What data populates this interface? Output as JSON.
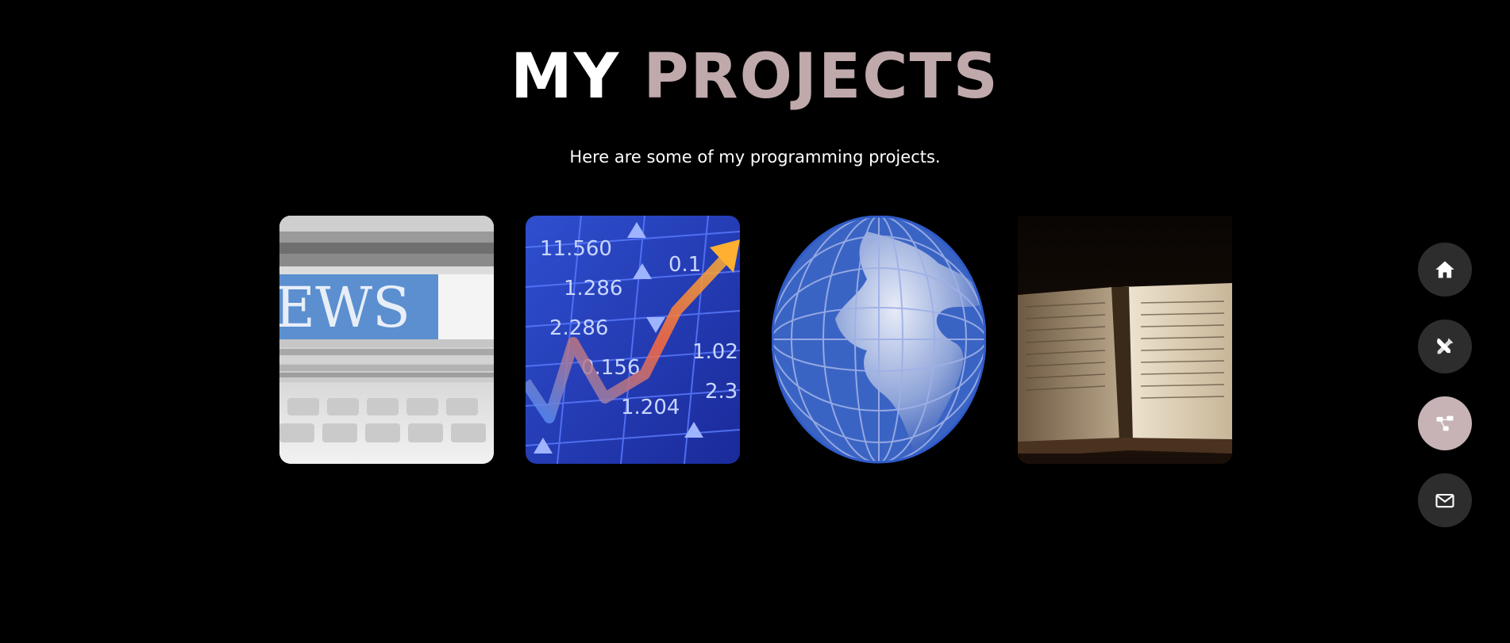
{
  "heading": {
    "word1": "MY",
    "word2": "PROJECTS"
  },
  "subtitle": "Here are some of my programming projects.",
  "projects": [
    {
      "image": "newspaper-stack-image"
    },
    {
      "image": "stock-market-chart-image"
    },
    {
      "image": "globe-image"
    },
    {
      "image": "old-book-image"
    }
  ],
  "side_nav": {
    "items": [
      {
        "icon": "home-icon",
        "active": false
      },
      {
        "icon": "tools-icon",
        "active": false
      },
      {
        "icon": "projects-icon",
        "active": true
      },
      {
        "icon": "mail-icon",
        "active": false
      }
    ],
    "colors": {
      "inactive_bg": "#2d2d2d",
      "active_bg": "#c7b3b5",
      "icon": "#ffffff"
    }
  },
  "colors": {
    "background": "#000000",
    "heading_primary": "#ffffff",
    "heading_accent": "#c0a9ab",
    "text": "#ffffff"
  }
}
